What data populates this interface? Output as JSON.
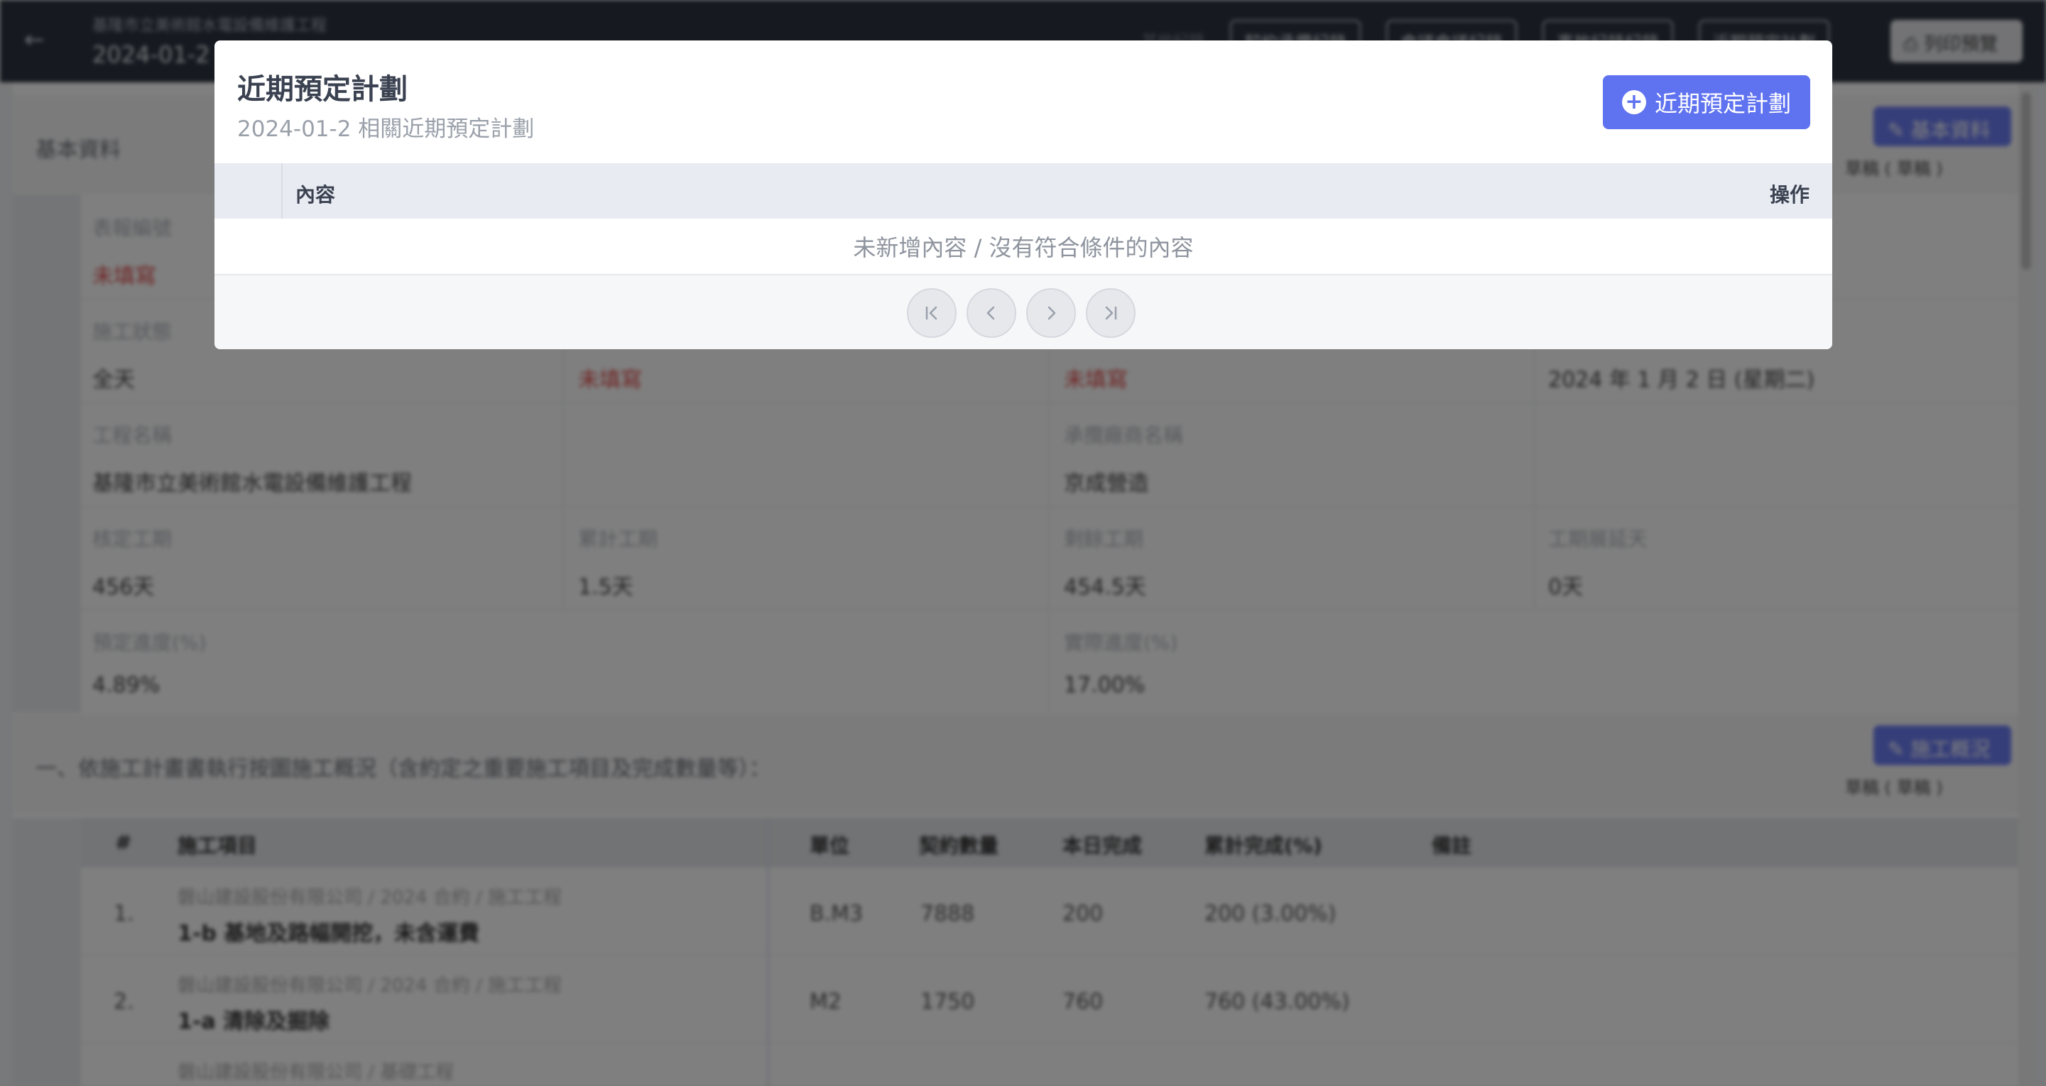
{
  "topbar": {
    "back_icon": "arrow-left-icon",
    "subtitle": "基隆市立美術館水電設備維護工程",
    "title": "2024-01-2",
    "label": "其他紀錄",
    "buttons": [
      "契約承攬紀錄",
      "會議會議紀錄",
      "事故紀錄紀錄",
      "近期預定計劃"
    ],
    "print_label": "列印預覽",
    "print_icon": "print-icon"
  },
  "basic": {
    "section_title": "基本資料",
    "edit_label": "基本資料",
    "links_label": "草稿 ( 草稿 )",
    "fields": {
      "form_no_label": "表報編號",
      "form_no_value": "未填寫",
      "weather_label": "施工狀態",
      "weather_value": "全天",
      "unfilled_1": "未填寫",
      "unfilled_2": "未填寫",
      "date_value": "2024 年 1 月 2 日 (星期二)",
      "project_name_label": "工程名稱",
      "project_name_value": "基隆市立美術館水電設備維護工程",
      "contractor_label": "承攬廠商名稱",
      "contractor_value": "京成營造",
      "approved_days_label": "核定工期",
      "approved_days_value": "456天",
      "used_days_label": "累計工期",
      "used_days_value": "1.5天",
      "remaining_days_label": "剩餘工期",
      "remaining_days_value": "454.5天",
      "extended_days_label": "工期展延天",
      "extended_days_value": "0天",
      "planned_progress_label": "預定進度(%)",
      "planned_progress_value": "4.89%",
      "actual_progress_label": "實際進度(%)",
      "actual_progress_value": "17.00%"
    }
  },
  "work": {
    "section_title": "一、依施工計畫書執行按圖施工概況（含約定之重要施工項目及完成數量等）：",
    "edit_label": "施工概況",
    "links_label": "草稿 ( 草稿 )",
    "headers": [
      "#",
      "施工項目",
      "單位",
      "契約數量",
      "本日完成",
      "累計完成(%)",
      "備註"
    ],
    "rows": [
      {
        "no": "1.",
        "company": "磐山建設股份有限公司 / 2024 合約 / 施工工程",
        "item": "1-b 基地及路幅開挖，未含運費",
        "unit": "B.M3",
        "qty": "7888",
        "today": "200",
        "total": "200 (3.00%)"
      },
      {
        "no": "2.",
        "company": "磐山建設股份有限公司 / 2024 合約 / 施工工程",
        "item": "1-a 清除及掘除",
        "unit": "M2",
        "qty": "1750",
        "today": "760",
        "total": "760 (43.00%)"
      },
      {
        "company": "磐山建設股份有限公司 / 基礎工程"
      }
    ]
  },
  "modal": {
    "title": "近期預定計劃",
    "subtitle": "2024-01-2 相關近期預定計劃",
    "add_button_label": "近期預定計劃",
    "add_icon": "plus-circle-icon",
    "table": {
      "col_content": "內容",
      "col_action": "操作",
      "empty_text": "未新增內容 / 沒有符合條件的內容"
    },
    "pager": {
      "first_icon": "first-page-icon",
      "prev_icon": "chevron-left-icon",
      "next_icon": "chevron-right-icon",
      "last_icon": "last-page-icon"
    }
  }
}
